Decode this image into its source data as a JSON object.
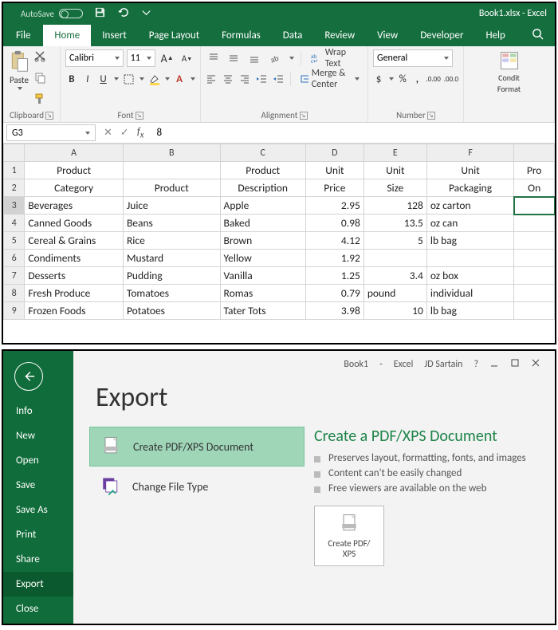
{
  "titlebar": {
    "autosave": "AutoSave",
    "doc_title": "Book1.xlsx - Excel"
  },
  "qat": {
    "save": "save-icon",
    "undo": "undo-icon",
    "back": "back-icon"
  },
  "tabs": [
    "File",
    "Home",
    "Insert",
    "Page Layout",
    "Formulas",
    "Data",
    "Review",
    "View",
    "Developer",
    "Help"
  ],
  "active_tab": "Home",
  "ribbon": {
    "clipboard": {
      "label": "Clipboard",
      "paste": "Paste"
    },
    "font": {
      "label": "Font",
      "name": "Calibri",
      "size": "11",
      "bold": "B",
      "italic": "I",
      "underline": "U"
    },
    "alignment": {
      "label": "Alignment",
      "wrap": "Wrap Text",
      "merge": "Merge & Center"
    },
    "number": {
      "label": "Number",
      "format": "General"
    },
    "styles": {
      "cf_line1": "Condit",
      "cf_line2": "Format"
    }
  },
  "namebox": {
    "ref": "G3",
    "formula": "8"
  },
  "grid": {
    "colhdr": [
      "",
      "A",
      "B",
      "C",
      "D",
      "E",
      "F",
      ""
    ],
    "header_row1": [
      "1",
      "Product",
      "",
      "Product",
      "Unit",
      "Unit",
      "Unit",
      "Pro"
    ],
    "header_row2": [
      "2",
      "Category",
      "Product",
      "Description",
      "Price",
      "Size",
      "Packaging",
      "On"
    ],
    "rows": [
      [
        "3",
        "Beverages",
        "Juice",
        "Apple",
        "2.95",
        "128",
        "oz carton",
        ""
      ],
      [
        "4",
        "Canned Goods",
        "Beans",
        "Baked",
        "0.98",
        "13.5",
        "oz can",
        ""
      ],
      [
        "5",
        "Cereal & Grains",
        "Rice",
        "Brown",
        "4.12",
        "5",
        "lb bag",
        ""
      ],
      [
        "6",
        "Condiments",
        "Mustard",
        "Yellow",
        "1.92",
        "",
        "",
        ""
      ],
      [
        "7",
        "Desserts",
        "Pudding",
        "Vanilla",
        "1.25",
        "3.4",
        "oz box",
        ""
      ],
      [
        "8",
        "Fresh Produce",
        "Tomatoes",
        "Romas",
        "0.79",
        "pound",
        "individual",
        ""
      ],
      [
        "9",
        "Frozen Foods",
        "Potatoes",
        "Tater Tots",
        "3.98",
        "10",
        "lb bag",
        ""
      ]
    ],
    "selected": {
      "row": 3,
      "col": 7
    }
  },
  "backstage": {
    "title_row": {
      "doc": "Book1",
      "app": "Excel",
      "user": "JD Sartain"
    },
    "nav": [
      "Info",
      "New",
      "Open",
      "Save",
      "Save As",
      "Print",
      "Share",
      "Export",
      "Close"
    ],
    "nav_selected": "Export",
    "h1": "Export",
    "options": [
      {
        "label": "Create PDF/XPS Document",
        "icon": "pdf-doc-icon",
        "selected": true
      },
      {
        "label": "Change File Type",
        "icon": "change-file-icon",
        "selected": false
      }
    ],
    "detail": {
      "heading": "Create a PDF/XPS Document",
      "bullets": [
        "Preserves layout, formatting, fonts, and images",
        "Content can't be easily changed",
        "Free viewers are available on the web"
      ],
      "button": "Create PDF/\nXPS"
    }
  }
}
